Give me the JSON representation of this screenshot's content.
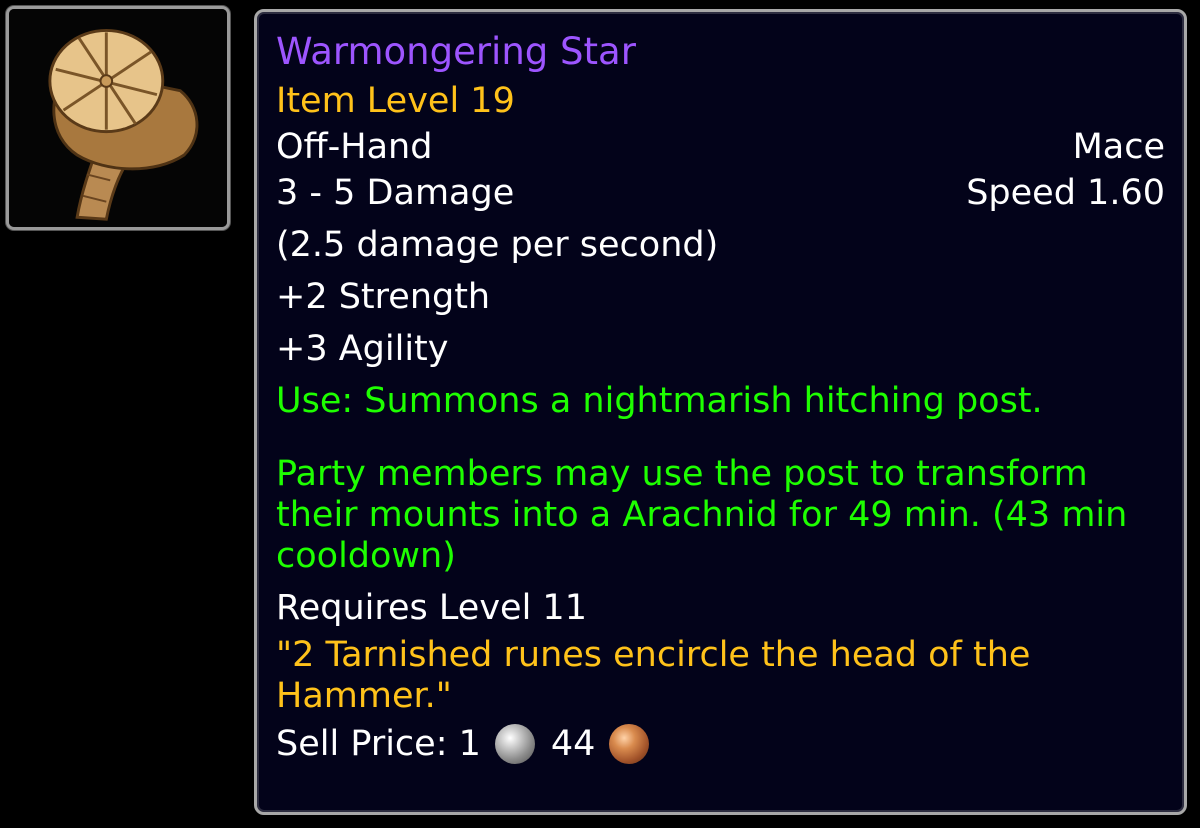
{
  "item": {
    "icon": "mace-icon",
    "name": "Warmongering Star",
    "item_level": "Item Level 19",
    "slot": "Off-Hand",
    "type": "Mace",
    "damage": "3 - 5 Damage",
    "speed": "Speed 1.60",
    "dps": "(2.5 damage per second)",
    "stats": [
      "+2 Strength",
      "+3 Agility"
    ],
    "use_line1": "Use: Summons a nightmarish hitching post.",
    "use_line2": "Party members may use the post to transform their mounts into a Arachnid for 49 min. (43 min cooldown)",
    "requires": "Requires Level 11",
    "flavor": "\"2 Tarnished runes encircle the head of the Hammer.\"",
    "sell_label": "Sell Price: 1",
    "sell_copper": "44"
  },
  "colors": {
    "epic": "#9d55ff",
    "gold": "#ffc21a",
    "green": "#1eff00",
    "background": "#03031a"
  }
}
